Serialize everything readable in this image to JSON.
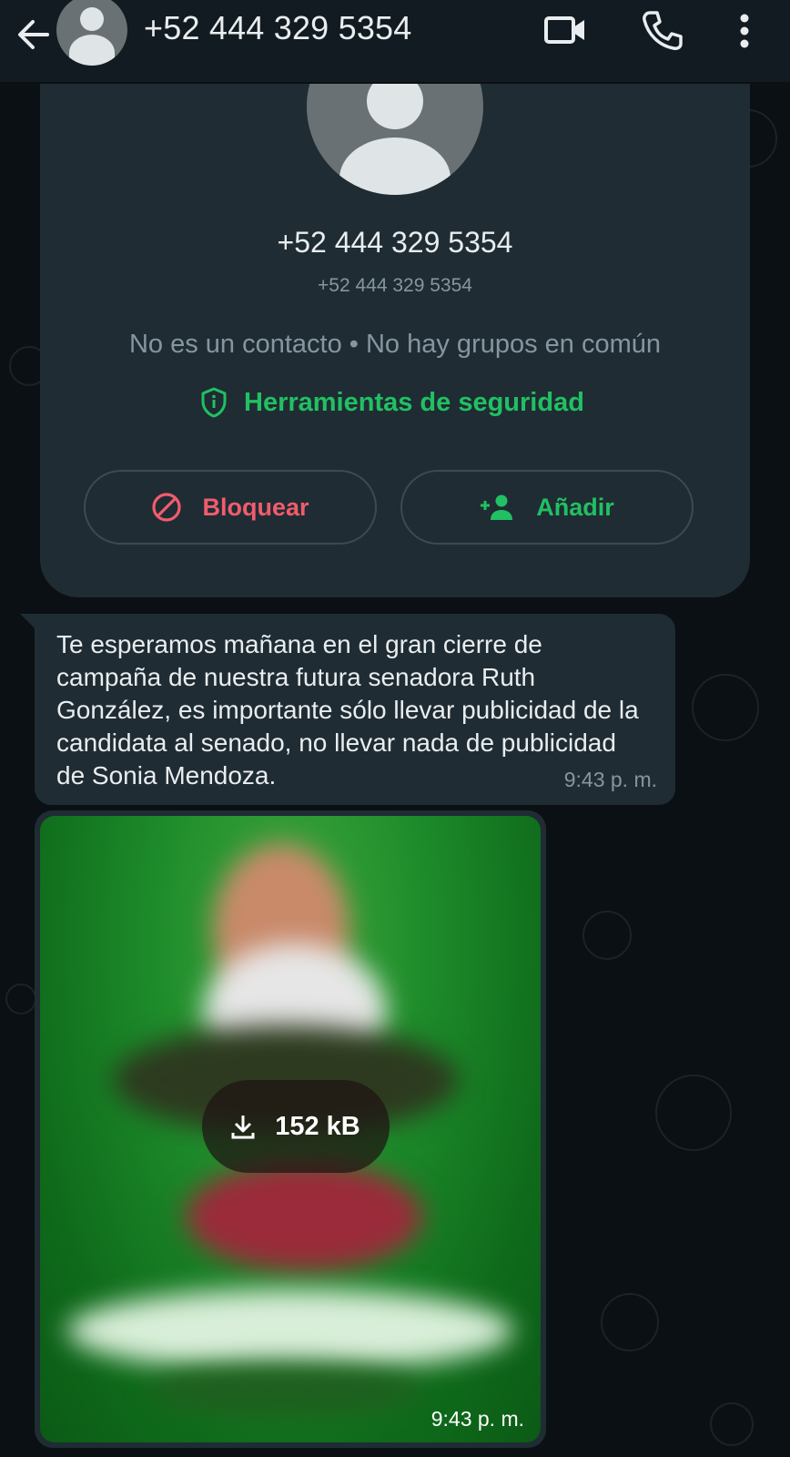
{
  "header": {
    "title": "+52 444 329 5354"
  },
  "contact_card": {
    "name": "+52 444 329 5354",
    "phone": "+52 444 329 5354",
    "status": "No es un contacto • No hay grupos en común",
    "security_tools_label": "Herramientas de seguridad",
    "block_label": "Bloquear",
    "add_label": "Añadir"
  },
  "messages": [
    {
      "text": "Te esperamos mañana en el gran cierre de campaña de nuestra futura senadora Ruth González, es importante sólo llevar publicidad de la candidata al senado, no llevar nada de publicidad de Sonia Mendoza.",
      "time": "9:43 p. m."
    },
    {
      "download_size": "152 kB",
      "time": "9:43 p. m."
    }
  ],
  "colors": {
    "accent_green": "#21c063",
    "danger_red": "#f15c6d",
    "bubble_bg": "#1f2c33",
    "appbar_bg": "#111b21",
    "chat_bg": "#0b1014"
  },
  "icons": [
    "back-arrow-icon",
    "avatar-icon",
    "video-call-icon",
    "phone-icon",
    "more-vert-icon",
    "shield-icon",
    "block-icon",
    "add-person-icon",
    "download-icon"
  ]
}
